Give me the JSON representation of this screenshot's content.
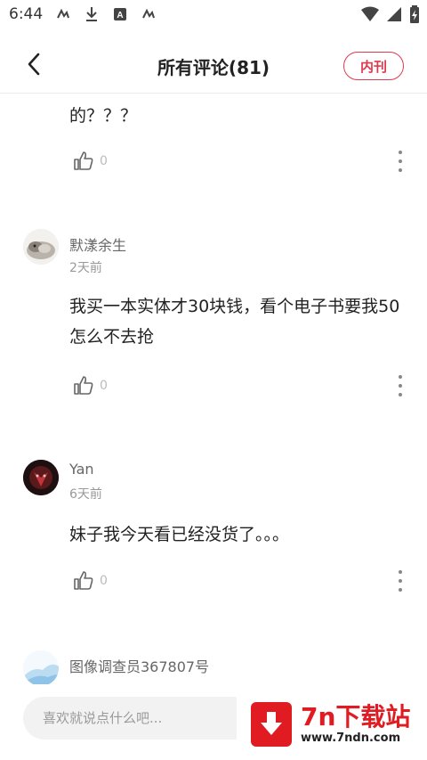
{
  "status_bar": {
    "time": "6:44"
  },
  "header": {
    "title": "所有评论(81)",
    "pill_label": "内刊",
    "accent": "#e0394e"
  },
  "comments": [
    {
      "username": "",
      "time": "",
      "content": "的？？？",
      "likes": "0",
      "avatar": "none"
    },
    {
      "username": "默漾余生",
      "time": "2天前",
      "content": "我买一本实体才30块钱，看个电子书要我50怎么不去抢",
      "likes": "0",
      "avatar": "cat-photo"
    },
    {
      "username": "Yan",
      "time": "6天前",
      "content": "妹子我今天看已经没货了。。。",
      "likes": "0",
      "avatar": "dark-red-photo"
    },
    {
      "username": "图像调查员367807号",
      "time": "",
      "content": "",
      "likes": "",
      "avatar": "blue-sky-photo"
    }
  ],
  "bottom_bar": {
    "placeholder": "喜欢就说点什么吧..."
  },
  "watermark": {
    "title": "7n下载站",
    "url": "www.7ndn.com",
    "color": "#e11b22"
  }
}
